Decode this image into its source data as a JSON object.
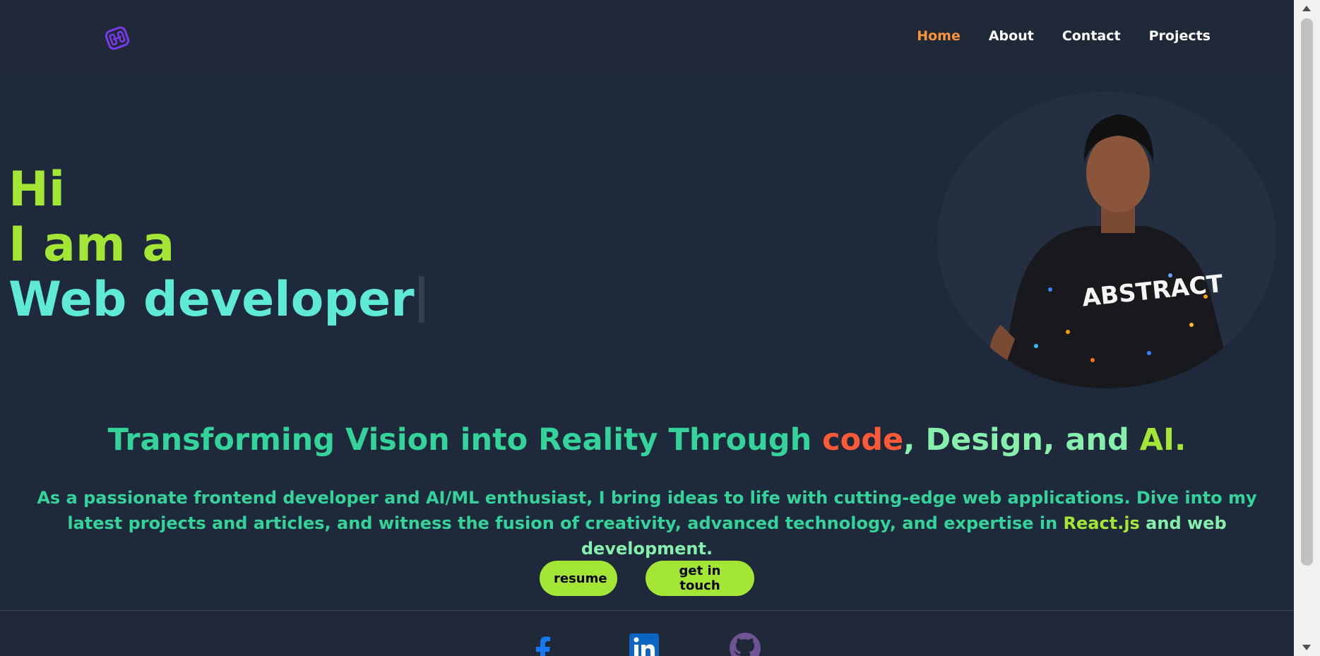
{
  "nav": {
    "logo_icon": "hexagon-logo-icon",
    "items": [
      {
        "label": "Home",
        "active": true
      },
      {
        "label": "About",
        "active": false
      },
      {
        "label": "Contact",
        "active": false
      },
      {
        "label": "Projects",
        "active": false
      }
    ]
  },
  "hero": {
    "line1": "Hi",
    "line2": "I am a",
    "line3": "Web developer"
  },
  "tagline": {
    "part_a": "Transforming Vision into Reality Through ",
    "code": "code",
    "part_b": ", Design, and ",
    "ai": "AI."
  },
  "intro": {
    "part1": "As a passionate frontend developer and AI/ML enthusiast, I bring ideas to life with cutting-edge web applications. Dive into my latest projects and articles, and witness the fusion of creativity, advanced technology, and expertise in ",
    "react": "React.js",
    "part2": " and web development."
  },
  "buttons": {
    "resume": "resume",
    "touch": "get in touch"
  },
  "social": [
    {
      "name": "facebook-icon",
      "color": "#1877f2"
    },
    {
      "name": "linkedin-icon",
      "color": "#0a66c2"
    },
    {
      "name": "github-icon",
      "color": "#6e5494"
    }
  ],
  "colors": {
    "background": "#1e293b",
    "accent_green": "#a3e635",
    "accent_teal": "#5eead4",
    "nav_active": "#fb923c",
    "code_red": "#ff5a36"
  }
}
